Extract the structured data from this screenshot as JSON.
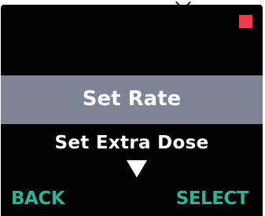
{
  "colors": {
    "screen_background": "#020202",
    "highlight_bar": "#7c8495",
    "menu_text": "#ffffff",
    "softkey_text": "#2fb29a",
    "status_indicator": "#ef3a4b"
  },
  "status": {
    "indicator_icon": "red-square-indicator"
  },
  "menu": {
    "selected_label": "Set Rate",
    "next_label": "Set Extra Dose",
    "scroll_icon": "down-triangle"
  },
  "softkeys": {
    "left_label": "BACK",
    "right_label": "SELECT"
  }
}
